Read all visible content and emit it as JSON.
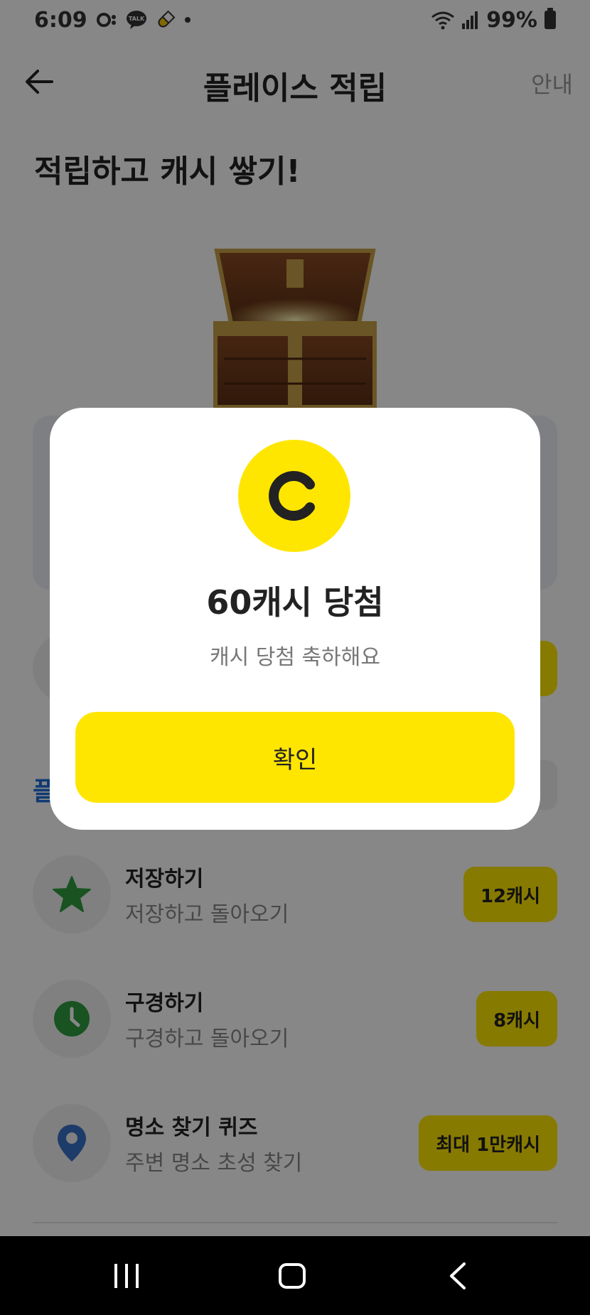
{
  "status_bar": {
    "time": "6:09",
    "talk_badge": "TALK",
    "battery": "99%"
  },
  "header": {
    "title": "플레이스 적립",
    "info_label": "안내"
  },
  "hero": {
    "title": "적립하고 캐시 쌓기!"
  },
  "background_section": {
    "partial_label": "플"
  },
  "tasks": [
    {
      "title": "저장하기",
      "subtitle": "저장하고 돌아오기",
      "reward": "12캐시",
      "icon": "star-icon",
      "icon_color": "#2e9e3f"
    },
    {
      "title": "구경하기",
      "subtitle": "구경하고 돌아오기",
      "reward": "8캐시",
      "icon": "clock-icon",
      "icon_color": "#2e9e3f"
    },
    {
      "title": "명소 찾기 퀴즈",
      "subtitle": "주변 명소 초성 찾기",
      "reward": "최대 1만캐시",
      "icon": "location-pin-icon",
      "icon_color": "#3a72c9"
    }
  ],
  "modal": {
    "coin_icon": "cash-coin-icon",
    "title": "60캐시 당첨",
    "subtitle": "캐시 당첨 축하해요",
    "confirm_label": "확인"
  },
  "colors": {
    "accent_yellow": "#ffe600",
    "section_blue": "#1e6fd9"
  }
}
